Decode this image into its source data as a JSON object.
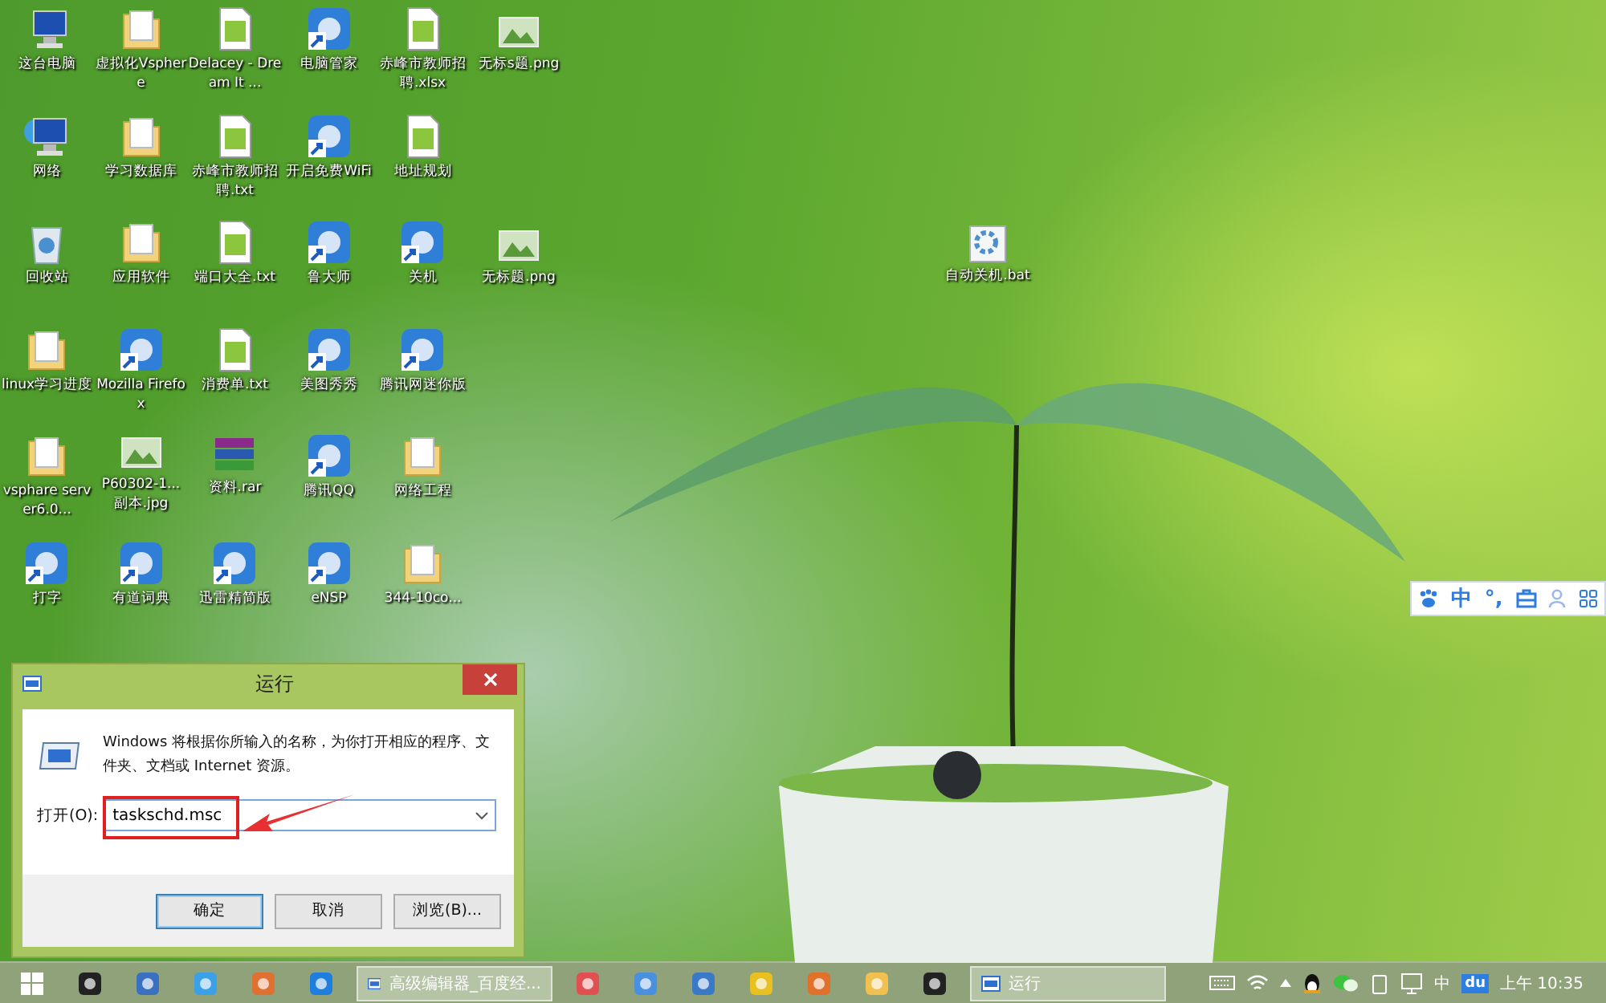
{
  "desktop": {
    "icons": [
      {
        "label": "这台电脑",
        "kind": "computer"
      },
      {
        "label": "网络",
        "kind": "network"
      },
      {
        "label": "回收站",
        "kind": "recycle"
      },
      {
        "label": "linux学习进度",
        "kind": "folder"
      },
      {
        "label": "vsphare server6.0...",
        "kind": "folder"
      },
      {
        "label": "打字",
        "kind": "app"
      },
      {
        "label": "虚拟化Vsphere",
        "kind": "folder"
      },
      {
        "label": "学习数据库",
        "kind": "folder"
      },
      {
        "label": "应用软件",
        "kind": "folder"
      },
      {
        "label": "Mozilla Firefox",
        "kind": "app"
      },
      {
        "label": "P60302-1... 副本.jpg",
        "kind": "image"
      },
      {
        "label": "有道词典",
        "kind": "app"
      },
      {
        "label": "Delacey - Dream It ...",
        "kind": "document"
      },
      {
        "label": "赤峰市教师招聘.txt",
        "kind": "document"
      },
      {
        "label": "端口大全.txt",
        "kind": "document"
      },
      {
        "label": "消费单.txt",
        "kind": "document"
      },
      {
        "label": "资料.rar",
        "kind": "archive"
      },
      {
        "label": "迅雷精简版",
        "kind": "app"
      },
      {
        "label": "电脑管家",
        "kind": "app"
      },
      {
        "label": "开启免费WiFi",
        "kind": "app"
      },
      {
        "label": "鲁大师",
        "kind": "app"
      },
      {
        "label": "美图秀秀",
        "kind": "app"
      },
      {
        "label": "腾讯QQ",
        "kind": "app"
      },
      {
        "label": "eNSP",
        "kind": "app"
      },
      {
        "label": "赤峰市教师招聘.xlsx",
        "kind": "document"
      },
      {
        "label": "地址规划",
        "kind": "document"
      },
      {
        "label": "关机",
        "kind": "app"
      },
      {
        "label": "腾讯网迷你版",
        "kind": "app"
      },
      {
        "label": "网络工程",
        "kind": "folder"
      },
      {
        "label": "344-10co...",
        "kind": "folder"
      }
    ],
    "loose_icons": [
      {
        "label": "无标s题.png",
        "kind": "image"
      },
      {
        "label": "无标题.png",
        "kind": "image"
      },
      {
        "label": "自动关机.bat",
        "kind": "script"
      }
    ]
  },
  "ime_bar": {
    "mode": "中",
    "punctuation": "°,"
  },
  "run_dialog": {
    "title": "运行",
    "description": "Windows 将根据你所输入的名称，为你打开相应的程序、文件夹、文档或 Internet 资源。",
    "open_label": "打开(O):",
    "input_value": "taskschd.msc",
    "buttons": [
      {
        "label": "确定",
        "default": true
      },
      {
        "label": "取消",
        "default": false
      },
      {
        "label": "浏览(B)...",
        "default": false
      }
    ]
  },
  "taskbar": {
    "items": [
      {
        "kind": "start"
      },
      {
        "kind": "icon"
      },
      {
        "kind": "icon"
      },
      {
        "kind": "icon"
      },
      {
        "kind": "icon"
      },
      {
        "kind": "icon"
      },
      {
        "kind": "window",
        "title": "高级编辑器_百度经..."
      },
      {
        "kind": "icon"
      },
      {
        "kind": "icon"
      },
      {
        "kind": "icon"
      },
      {
        "kind": "icon"
      },
      {
        "kind": "icon"
      },
      {
        "kind": "icon"
      },
      {
        "kind": "icon"
      },
      {
        "kind": "window",
        "title": "运行"
      }
    ],
    "tray": {
      "ime": "中",
      "baidu": "du",
      "clock": "上午 10:35"
    }
  }
}
